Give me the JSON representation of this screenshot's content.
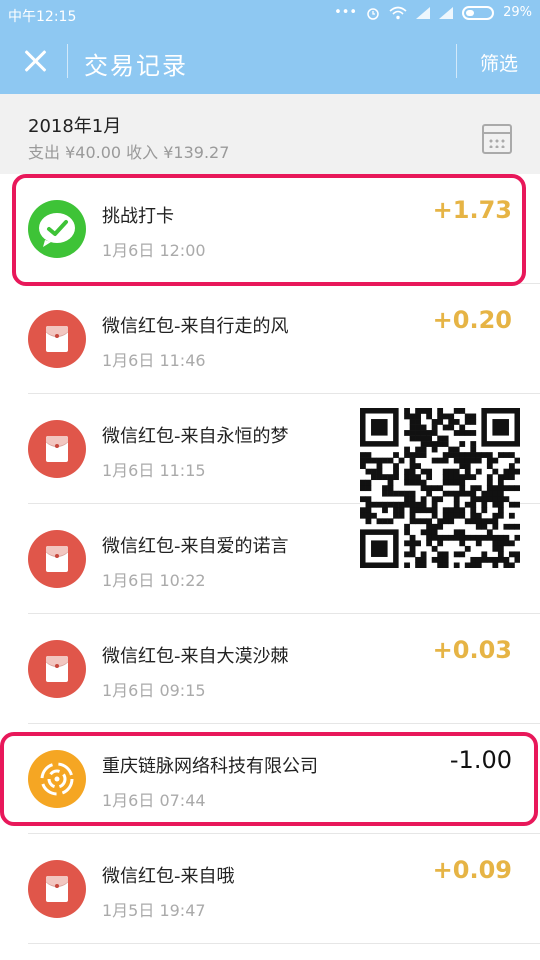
{
  "status_bar": {
    "time": "中午12:15",
    "icons": [
      "more-dots-icon",
      "alarm-icon",
      "wifi-icon",
      "signal-icon",
      "signal-icon",
      "battery-icon"
    ],
    "battery": "29%"
  },
  "header": {
    "title": "交易记录",
    "filter_label": "筛选"
  },
  "month_bar": {
    "month": "2018年1月",
    "summary": "支出 ¥40.00 收入 ¥139.27"
  },
  "transactions": [
    {
      "name": "挑战打卡",
      "date": "1月6日 12:00",
      "amount": "+1.73",
      "icon": "wechat-checkin-icon",
      "highlighted": true
    },
    {
      "name": "微信红包-来自行走的风",
      "date": "1月6日 11:46",
      "amount": "+0.20",
      "icon": "red-packet-icon"
    },
    {
      "name": "微信红包-来自永恒的梦",
      "date": "1月6日 11:15",
      "amount": "",
      "icon": "red-packet-icon"
    },
    {
      "name": "微信红包-来自爱的诺言",
      "date": "1月6日 10:22",
      "amount": "",
      "icon": "red-packet-icon"
    },
    {
      "name": "微信红包-来自大漠沙棘",
      "date": "1月6日 09:15",
      "amount": "+0.03",
      "icon": "red-packet-icon"
    },
    {
      "name": "重庆链脉网络科技有限公司",
      "date": "1月6日 07:44",
      "amount": "-1.00",
      "icon": "company-logo-icon",
      "highlighted": true
    },
    {
      "name": "微信红包-来自哦",
      "date": "1月5日 19:47",
      "amount": "+0.09",
      "icon": "red-packet-icon"
    }
  ],
  "colors": {
    "header": "#8ec8f2",
    "income": "#e6b445",
    "highlight": "#e8185a",
    "red_packet": "#e0564a",
    "checkin_green": "#3ec337"
  }
}
